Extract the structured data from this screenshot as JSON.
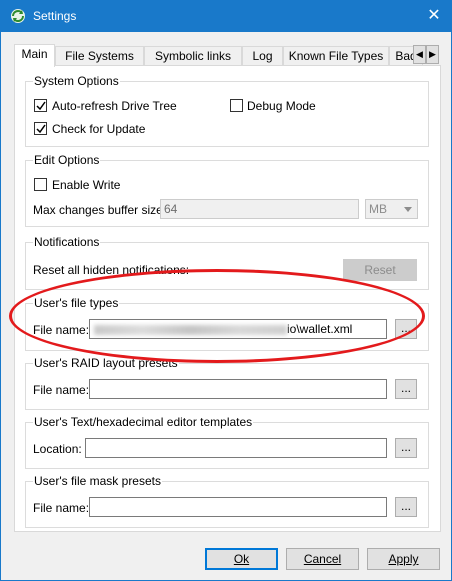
{
  "window": {
    "title": "Settings",
    "close_glyph": "✕",
    "app_icon": "refresh-arrows-icon"
  },
  "tabs": [
    "Main",
    "File Systems",
    "Symbolic links",
    "Log",
    "Known File Types",
    "Bad"
  ],
  "tab_scroll": {
    "prev": "◀",
    "next": "▶"
  },
  "system_options": {
    "title": "System Options",
    "auto_refresh": {
      "label": "Auto-refresh Drive Tree",
      "checked": true
    },
    "check_update": {
      "label": "Check for Update",
      "checked": true
    },
    "debug_mode": {
      "label": "Debug Mode",
      "checked": false
    }
  },
  "edit_options": {
    "title": "Edit Options",
    "enable_write": {
      "label": "Enable Write",
      "checked": false
    },
    "buffer_label": "Max changes buffer size:",
    "buffer_value": "64",
    "buffer_unit": "MB"
  },
  "notifications": {
    "title": "Notifications",
    "reset_label": "Reset all hidden notifications:",
    "reset_button": "Reset"
  },
  "file_types": {
    "title": "User's file types",
    "label": "File name:",
    "value_suffix": "io\\wallet.xml",
    "browse": "..."
  },
  "raid_presets": {
    "title": "User's RAID layout presets",
    "label": "File name:",
    "value": "",
    "browse": "..."
  },
  "editor_templates": {
    "title": "User's Text/hexadecimal editor templates",
    "label": "Location:",
    "value": "",
    "browse": "..."
  },
  "mask_presets": {
    "title": "User's file mask presets",
    "label": "File name:",
    "value": "",
    "browse": "..."
  },
  "buttons": {
    "ok": "Ok",
    "cancel": "Cancel",
    "apply": "Apply"
  },
  "colors": {
    "titlebar": "#1979ca",
    "annotation": "#e31a1c",
    "focus": "#0078d7"
  }
}
